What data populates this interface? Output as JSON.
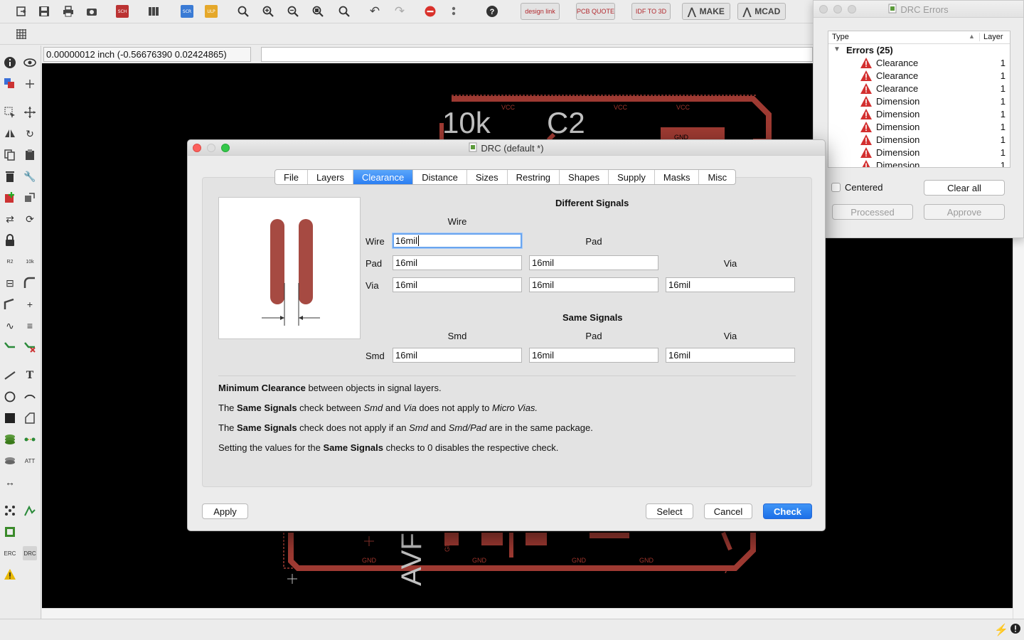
{
  "toolbar": {
    "brand_buttons": [
      "design link",
      "PCB QUOTE",
      "IDF TO 3D"
    ],
    "make_label": "MAKE",
    "mcad_label": "MCAD",
    "icons": [
      "open-icon",
      "save-icon",
      "print-icon",
      "camera-icon",
      "sch-brd-icon",
      "library-icon",
      "scr-icon",
      "ulp-icon",
      "zoom-fit-icon",
      "zoom-in-icon",
      "zoom-out-icon",
      "zoom-select-icon",
      "zoom-dropdown-icon",
      "undo-icon",
      "redo-icon",
      "stop-icon",
      "dots-icon",
      "help-icon"
    ]
  },
  "coordinate_readout": "0.00000012 inch (-0.56676390 0.02424865)",
  "board": {
    "labels": [
      "10k",
      "C2",
      "AVF"
    ],
    "net_labels": [
      "VCC",
      "VCC",
      "VCC",
      "GND",
      "GND",
      "GND",
      "GND",
      "GND",
      "GND"
    ]
  },
  "drc_errors": {
    "title": "DRC Errors",
    "col_type": "Type",
    "col_layer": "Layer",
    "group": "Errors (25)",
    "rows": [
      {
        "type": "Clearance",
        "layer": "1"
      },
      {
        "type": "Clearance",
        "layer": "1"
      },
      {
        "type": "Clearance",
        "layer": "1"
      },
      {
        "type": "Dimension",
        "layer": "1"
      },
      {
        "type": "Dimension",
        "layer": "1"
      },
      {
        "type": "Dimension",
        "layer": "1"
      },
      {
        "type": "Dimension",
        "layer": "1"
      },
      {
        "type": "Dimension",
        "layer": "1"
      },
      {
        "type": "Dimension",
        "layer": "1"
      }
    ],
    "centered_label": "Centered",
    "centered_checked": false,
    "clear_all": "Clear all",
    "processed": "Processed",
    "approve": "Approve"
  },
  "drc_dialog": {
    "title": "DRC (default *)",
    "tabs": [
      "File",
      "Layers",
      "Clearance",
      "Distance",
      "Sizes",
      "Restring",
      "Shapes",
      "Supply",
      "Masks",
      "Misc"
    ],
    "active_tab": "Clearance",
    "different_signals": {
      "title": "Different Signals",
      "col_wire": "Wire",
      "col_pad": "Pad",
      "col_via": "Via",
      "row_wire": "Wire",
      "row_pad": "Pad",
      "row_via": "Via",
      "wire_wire": "16mil",
      "pad_wire": "16mil",
      "pad_pad": "16mil",
      "via_wire": "16mil",
      "via_pad": "16mil",
      "via_via": "16mil"
    },
    "same_signals": {
      "title": "Same Signals",
      "col_smd": "Smd",
      "col_pad": "Pad",
      "col_via": "Via",
      "row_smd": "Smd",
      "smd_smd": "16mil",
      "smd_pad": "16mil",
      "smd_via": "16mil"
    },
    "info": {
      "l1_b": "Minimum Clearance",
      "l1_t": " between objects in signal layers.",
      "l2_a": "The ",
      "l2_b": "Same Signals",
      "l2_c": " check between ",
      "l2_i1": "Smd",
      "l2_d": " and ",
      "l2_i2": "Via",
      "l2_e": " does not apply to ",
      "l2_i3": "Micro Vias.",
      "l3_a": "The ",
      "l3_b": "Same Signals",
      "l3_c": " check does not apply if an ",
      "l3_i1": "Smd",
      "l3_d": " and ",
      "l3_i2": "Smd/Pad",
      "l3_e": " are in the same package.",
      "l4_a": "Setting the values for the ",
      "l4_b": "Same Signals",
      "l4_c": " checks to 0 disables the respective check."
    },
    "apply": "Apply",
    "select": "Select",
    "cancel": "Cancel",
    "check": "Check"
  },
  "colors": {
    "copper": "#9e3a32",
    "accent": "#2b7ef2",
    "canvas": "#000000"
  }
}
